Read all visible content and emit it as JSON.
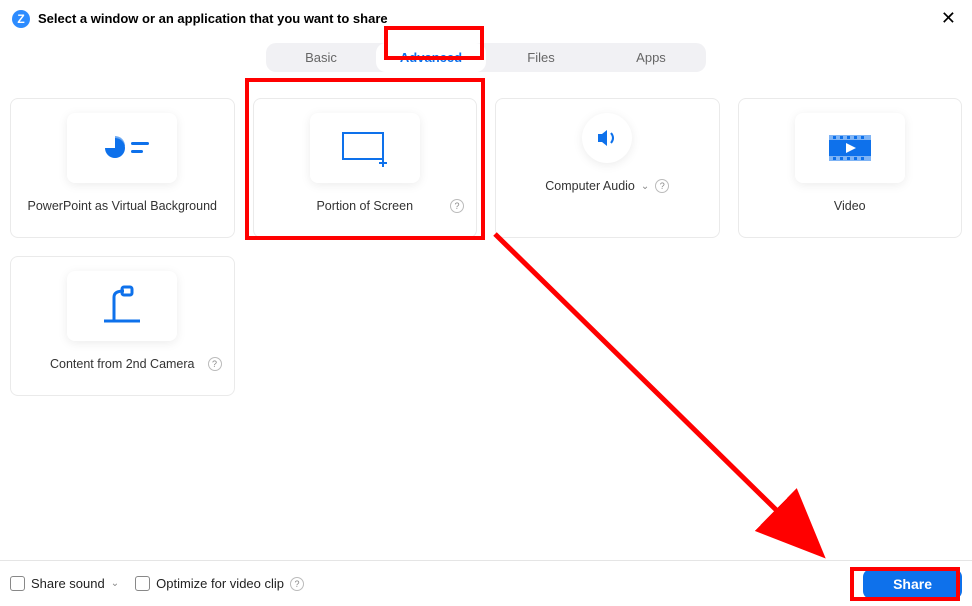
{
  "header": {
    "title": "Select a window or an application that you want to share",
    "logo_letter": "Z"
  },
  "tabs": {
    "basic": "Basic",
    "advanced": "Advanced",
    "files": "Files",
    "apps": "Apps"
  },
  "cards": {
    "ppt": "PowerPoint as Virtual Background",
    "portion": "Portion of Screen",
    "audio": "Computer Audio",
    "video": "Video",
    "camera2": "Content from 2nd Camera"
  },
  "footer": {
    "share_sound": "Share sound",
    "optimize": "Optimize for video clip",
    "share_btn": "Share"
  },
  "glyph": {
    "help": "?",
    "chev_down": "⌄",
    "close": "✕"
  }
}
